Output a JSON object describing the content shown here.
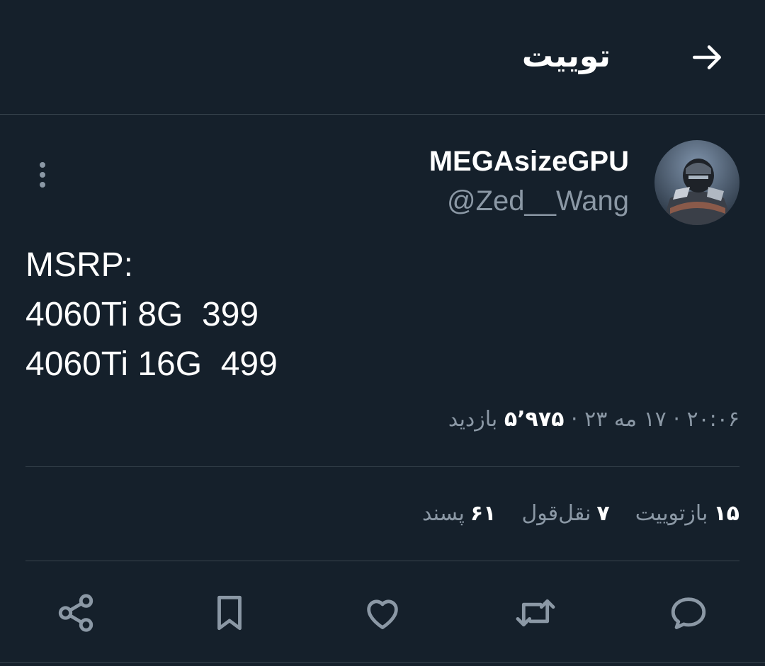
{
  "header": {
    "title": "توییت",
    "back_icon": "arrow-right-icon"
  },
  "tweet": {
    "display_name": "MEGAsizeGPU",
    "handle": "@Zed__Wang",
    "text": "MSRP:\n4060Ti 8G  399\n4060Ti 16G  499",
    "time": "۲۰:۰۶",
    "sep": "·",
    "date": "۱۷ مه ۲۳",
    "views_count": "۵٬۹۷۵",
    "views_label": "بازدید"
  },
  "stats": {
    "retweets_count": "۱۵",
    "retweets_label": "بازتوییت",
    "quotes_count": "۷",
    "quotes_label": "نقل‌قول",
    "likes_count": "۶۱",
    "likes_label": "پسند"
  },
  "colors": {
    "background": "#15202b",
    "muted_text": "#8b98a5",
    "divider": "#38444d"
  },
  "actions": [
    "share-icon",
    "bookmark-icon",
    "heart-icon",
    "retweet-icon",
    "reply-icon"
  ]
}
